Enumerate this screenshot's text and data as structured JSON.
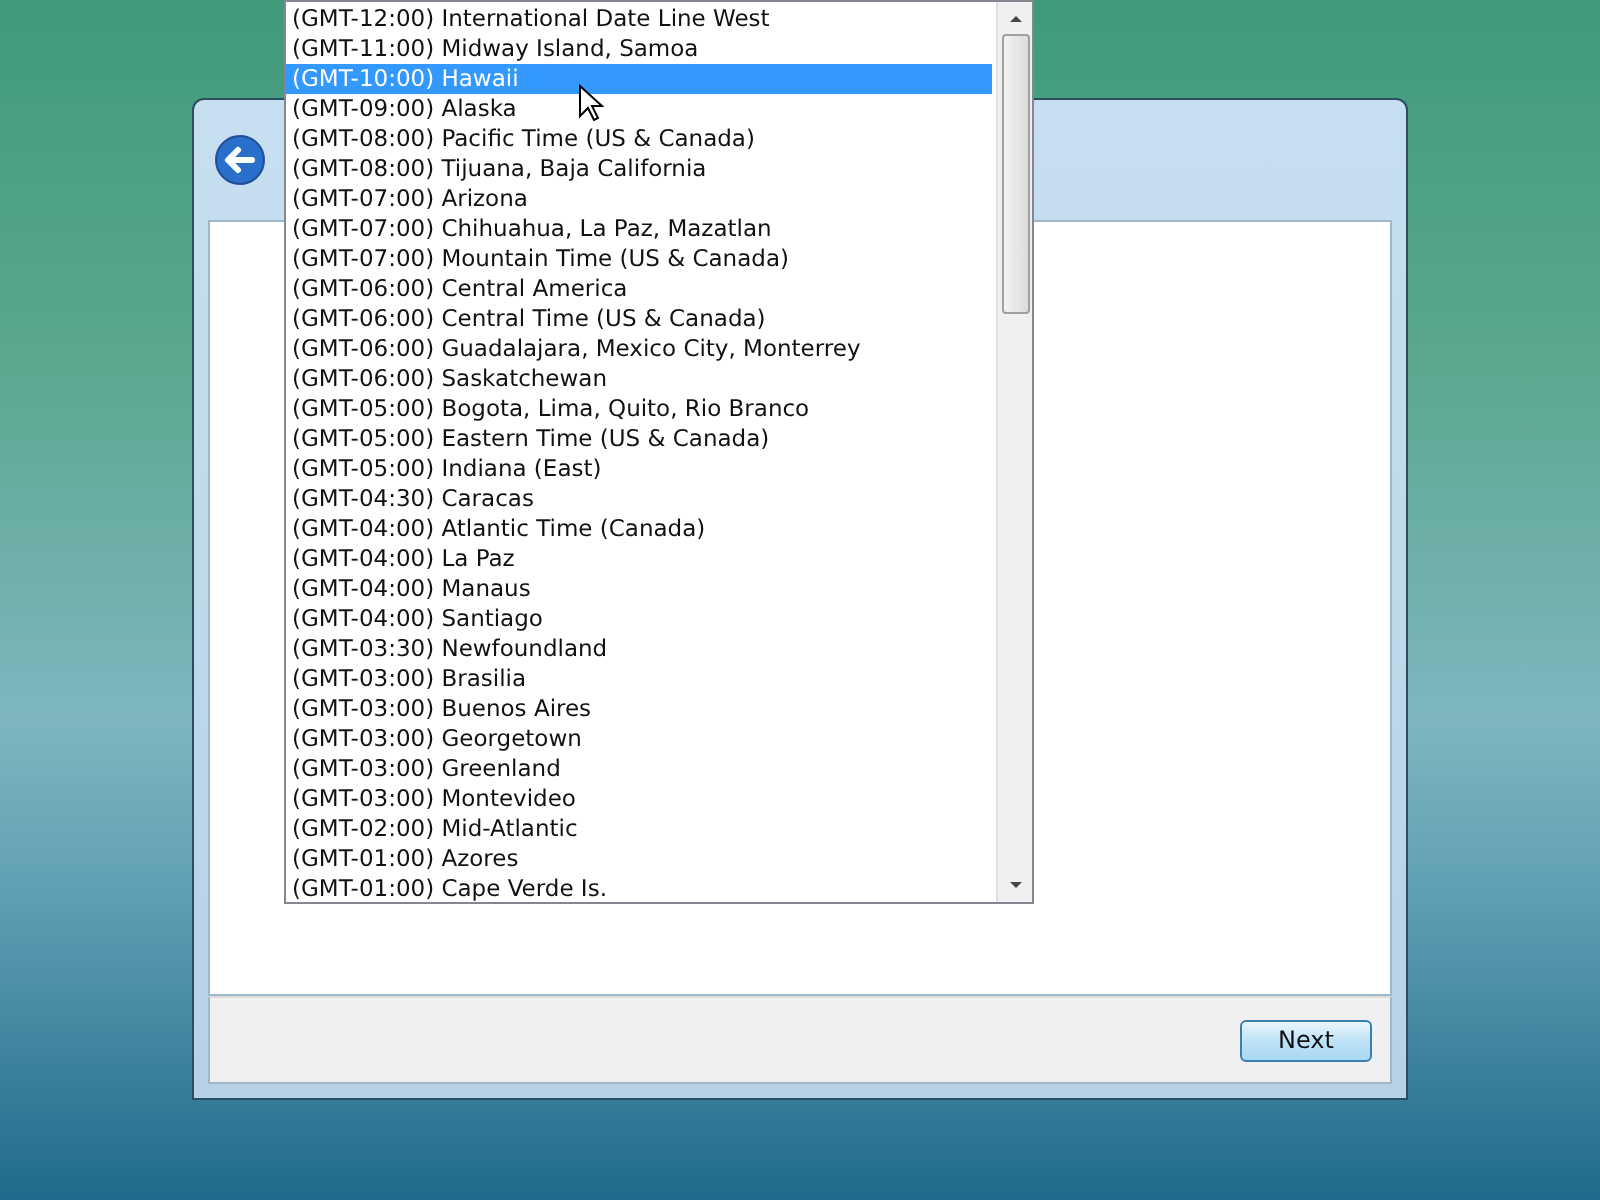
{
  "dialog": {
    "next_button": "Next"
  },
  "timezone_list": {
    "items": [
      {
        "label": "(GMT-12:00) International Date Line West",
        "selected": false
      },
      {
        "label": "(GMT-11:00) Midway Island, Samoa",
        "selected": false
      },
      {
        "label": "(GMT-10:00) Hawaii",
        "selected": true
      },
      {
        "label": "(GMT-09:00) Alaska",
        "selected": false
      },
      {
        "label": "(GMT-08:00) Pacific Time (US & Canada)",
        "selected": false
      },
      {
        "label": "(GMT-08:00) Tijuana, Baja California",
        "selected": false
      },
      {
        "label": "(GMT-07:00) Arizona",
        "selected": false
      },
      {
        "label": "(GMT-07:00) Chihuahua, La Paz, Mazatlan",
        "selected": false
      },
      {
        "label": "(GMT-07:00) Mountain Time (US & Canada)",
        "selected": false
      },
      {
        "label": "(GMT-06:00) Central America",
        "selected": false
      },
      {
        "label": "(GMT-06:00) Central Time (US & Canada)",
        "selected": false
      },
      {
        "label": "(GMT-06:00) Guadalajara, Mexico City, Monterrey",
        "selected": false
      },
      {
        "label": "(GMT-06:00) Saskatchewan",
        "selected": false
      },
      {
        "label": "(GMT-05:00) Bogota, Lima, Quito, Rio Branco",
        "selected": false
      },
      {
        "label": "(GMT-05:00) Eastern Time (US & Canada)",
        "selected": false
      },
      {
        "label": "(GMT-05:00) Indiana (East)",
        "selected": false
      },
      {
        "label": "(GMT-04:30) Caracas",
        "selected": false
      },
      {
        "label": "(GMT-04:00) Atlantic Time (Canada)",
        "selected": false
      },
      {
        "label": "(GMT-04:00) La Paz",
        "selected": false
      },
      {
        "label": "(GMT-04:00) Manaus",
        "selected": false
      },
      {
        "label": "(GMT-04:00) Santiago",
        "selected": false
      },
      {
        "label": "(GMT-03:30) Newfoundland",
        "selected": false
      },
      {
        "label": "(GMT-03:00) Brasilia",
        "selected": false
      },
      {
        "label": "(GMT-03:00) Buenos Aires",
        "selected": false
      },
      {
        "label": "(GMT-03:00) Georgetown",
        "selected": false
      },
      {
        "label": "(GMT-03:00) Greenland",
        "selected": false
      },
      {
        "label": "(GMT-03:00) Montevideo",
        "selected": false
      },
      {
        "label": "(GMT-02:00) Mid-Atlantic",
        "selected": false
      },
      {
        "label": "(GMT-01:00) Azores",
        "selected": false
      },
      {
        "label": "(GMT-01:00) Cape Verde Is.",
        "selected": false
      }
    ]
  }
}
